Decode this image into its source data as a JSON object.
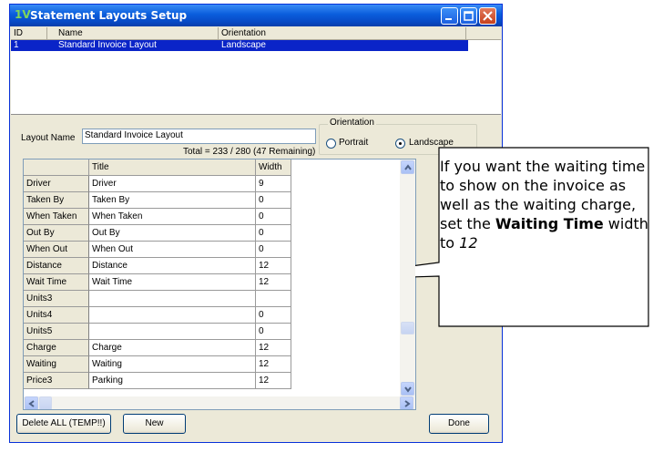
{
  "window": {
    "title": "Statement Layouts Setup",
    "app_icon": "1V"
  },
  "list": {
    "columns": [
      "ID",
      "Name",
      "Orientation"
    ],
    "rows": [
      {
        "id": "1",
        "name": "Standard Invoice Layout",
        "orientation": "Landscape",
        "selected": true
      }
    ]
  },
  "form": {
    "layout_name_label": "Layout Name",
    "layout_name_value": "Standard Invoice Layout",
    "total_text": "Total = 233 / 280 (47 Remaining)",
    "orientation_label": "Orientation",
    "portrait_label": "Portrait",
    "landscape_label": "Landscape",
    "selected_orientation": "Landscape"
  },
  "grid": {
    "headers": [
      "",
      "Title",
      "Width"
    ],
    "rows": [
      {
        "field": "Driver",
        "title": "Driver",
        "width": "9"
      },
      {
        "field": "Taken By",
        "title": "Taken By",
        "width": "0"
      },
      {
        "field": "When Taken",
        "title": "When Taken",
        "width": "0"
      },
      {
        "field": "Out By",
        "title": "Out By",
        "width": "0"
      },
      {
        "field": "When Out",
        "title": "When Out",
        "width": "0"
      },
      {
        "field": "Distance",
        "title": "Distance",
        "width": "12"
      },
      {
        "field": "Wait Time",
        "title": "Wait Time",
        "width": "12"
      },
      {
        "field": "Units3",
        "title": "",
        "width": ""
      },
      {
        "field": "Units4",
        "title": "",
        "width": "0"
      },
      {
        "field": "Units5",
        "title": "",
        "width": "0"
      },
      {
        "field": "Charge",
        "title": "Charge",
        "width": "12"
      },
      {
        "field": "Waiting",
        "title": "Waiting",
        "width": "12"
      },
      {
        "field": "Price3",
        "title": "Parking",
        "width": "12"
      }
    ]
  },
  "buttons": {
    "delete_all": "Delete ALL (TEMP!!)",
    "new": "New",
    "done": "Done"
  },
  "callout": {
    "text_1": "If you want the waiting time to show on the invoice as well as the waiting charge, set the ",
    "bold": "Waiting Time",
    "text_2": " width to ",
    "italic": "12"
  },
  "colors": {
    "title_bar": "#0a5ddc",
    "selection": "#0a24c8",
    "dialog_bg": "#ece9d8"
  }
}
